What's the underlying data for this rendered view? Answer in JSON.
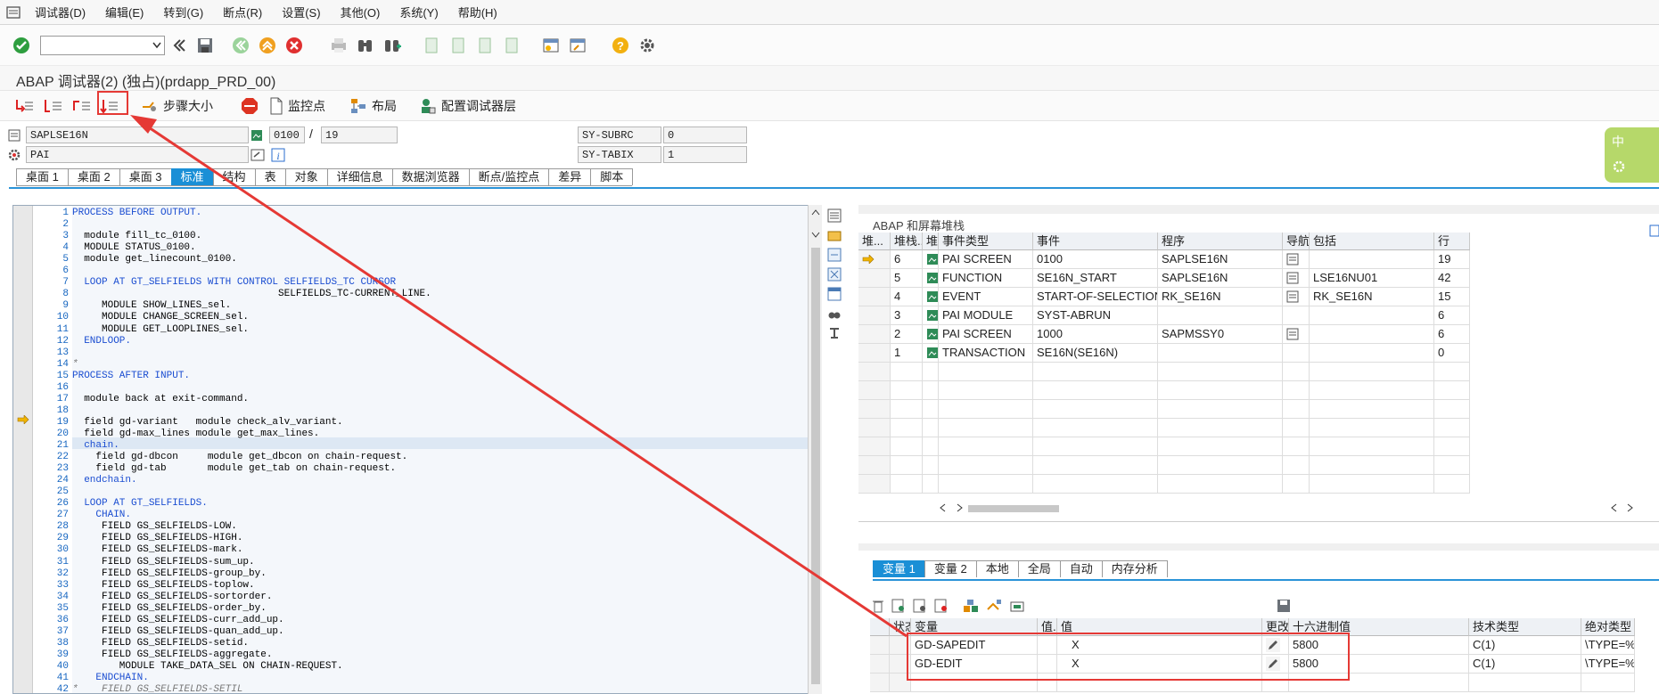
{
  "menu": [
    "调试器(D)",
    "编辑(E)",
    "转到(G)",
    "断点(R)",
    "设置(S)",
    "其他(O)",
    "系统(Y)",
    "帮助(H)"
  ],
  "title": "ABAP 调试器(2)   (独占)(prdapp_PRD_00)",
  "app_toolbar": {
    "step_size": "步骤大小",
    "watchpoint": "监控点",
    "layout": "布局",
    "config_layer": "配置调试器层"
  },
  "fields": {
    "program": "SAPLSE16N",
    "screen": "0100",
    "slash": "/",
    "line": "19",
    "event": "PAI",
    "sy_subrc_label": "SY-SUBRC",
    "sy_subrc_value": "0",
    "sy_tabix_label": "SY-TABIX",
    "sy_tabix_value": "1"
  },
  "ime_label": "中",
  "main_tabs": [
    "桌面 1",
    "桌面 2",
    "桌面 3",
    "标准",
    "结构",
    "表",
    "对象",
    "详细信息",
    "数据浏览器",
    "断点/监控点",
    "差异",
    "脚本"
  ],
  "active_main_tab": 3,
  "code_lines": [
    {
      "n": "1",
      "t": "PROCESS BEFORE OUTPUT."
    },
    {
      "n": "2",
      "t": ""
    },
    {
      "n": "3",
      "t": "  module fill_tc_0100."
    },
    {
      "n": "4",
      "t": "  MODULE STATUS_0100."
    },
    {
      "n": "5",
      "t": "  module get_linecount_0100."
    },
    {
      "n": "6",
      "t": ""
    },
    {
      "n": "7",
      "t": "  LOOP AT GT_SELFIELDS WITH CONTROL SELFIELDS_TC CURSOR"
    },
    {
      "n": "8",
      "t": "                                   SELFIELDS_TC-CURRENT_LINE."
    },
    {
      "n": "9",
      "t": "     MODULE SHOW_LINES_sel."
    },
    {
      "n": "10",
      "t": "     MODULE CHANGE_SCREEN_sel."
    },
    {
      "n": "11",
      "t": "     MODULE GET_LOOPLINES_sel."
    },
    {
      "n": "12",
      "t": "  ENDLOOP."
    },
    {
      "n": "13",
      "t": ""
    },
    {
      "n": "14",
      "t": "*"
    },
    {
      "n": "15",
      "t": "PROCESS AFTER INPUT."
    },
    {
      "n": "16",
      "t": ""
    },
    {
      "n": "17",
      "t": "  module back at exit-command."
    },
    {
      "n": "18",
      "t": ""
    },
    {
      "n": "19",
      "t": "  field gd-variant   module check_alv_variant."
    },
    {
      "n": "20",
      "t": "  field gd-max_lines module get_max_lines."
    },
    {
      "n": "21",
      "t": "  chain."
    },
    {
      "n": "22",
      "t": "    field gd-dbcon     module get_dbcon on chain-request."
    },
    {
      "n": "23",
      "t": "    field gd-tab       module get_tab on chain-request."
    },
    {
      "n": "24",
      "t": "  endchain."
    },
    {
      "n": "25",
      "t": ""
    },
    {
      "n": "26",
      "t": "  LOOP AT GT_SELFIELDS."
    },
    {
      "n": "27",
      "t": "    CHAIN."
    },
    {
      "n": "28",
      "t": "     FIELD GS_SELFIELDS-LOW."
    },
    {
      "n": "29",
      "t": "     FIELD GS_SELFIELDS-HIGH."
    },
    {
      "n": "30",
      "t": "     FIELD GS_SELFIELDS-mark."
    },
    {
      "n": "31",
      "t": "     FIELD GS_SELFIELDS-sum_up."
    },
    {
      "n": "32",
      "t": "     FIELD GS_SELFIELDS-group_by."
    },
    {
      "n": "33",
      "t": "     FIELD GS_SELFIELDS-toplow."
    },
    {
      "n": "34",
      "t": "     FIELD GS_SELFIELDS-sortorder."
    },
    {
      "n": "35",
      "t": "     FIELD GS_SELFIELDS-order_by."
    },
    {
      "n": "36",
      "t": "     FIELD GS_SELFIELDS-curr_add_up."
    },
    {
      "n": "37",
      "t": "     FIELD GS_SELFIELDS-quan_add_up."
    },
    {
      "n": "38",
      "t": "     FIELD GS_SELFIELDS-setid."
    },
    {
      "n": "39",
      "t": "     FIELD GS_SELFIELDS-aggregate."
    },
    {
      "n": "40",
      "t": "        MODULE TAKE_DATA_SEL ON CHAIN-REQUEST."
    },
    {
      "n": "41",
      "t": "    ENDCHAIN."
    },
    {
      "n": "42",
      "t": "*    FIELD GS_SELFIELDS-SETIL"
    }
  ],
  "stack_panel": {
    "title": "ABAP 和屏幕堆栈",
    "headers": [
      "堆...",
      "堆栈...",
      "堆.",
      "事件类型",
      "事件",
      "程序",
      "导航",
      "包括",
      "行"
    ],
    "rows": [
      {
        "depth": "6",
        "type": "PAI SCREEN",
        "event": "0100",
        "program": "SAPLSE16N",
        "include": "",
        "line": "19",
        "nav": true,
        "current": true
      },
      {
        "depth": "5",
        "type": "FUNCTION",
        "event": "SE16N_START",
        "program": "SAPLSE16N",
        "include": "LSE16NU01",
        "line": "42",
        "nav": true,
        "current": false
      },
      {
        "depth": "4",
        "type": "EVENT",
        "event": "START-OF-SELECTION",
        "program": "RK_SE16N",
        "include": "RK_SE16N",
        "line": "15",
        "nav": true,
        "current": false
      },
      {
        "depth": "3",
        "type": "PAI MODULE",
        "event": "SYST-ABRUN",
        "program": "",
        "include": "",
        "line": "6",
        "nav": false,
        "current": false
      },
      {
        "depth": "2",
        "type": "PAI SCREEN",
        "event": "1000",
        "program": "SAPMSSY0",
        "include": "",
        "line": "6",
        "nav": true,
        "current": false
      },
      {
        "depth": "1",
        "type": "TRANSACTION",
        "event": "SE16N(SE16N)",
        "program": "",
        "include": "",
        "line": "0",
        "nav": false,
        "current": false
      }
    ]
  },
  "var_tabs": [
    "变量 1",
    "变量 2",
    "本地",
    "全局",
    "自动",
    "内存分析"
  ],
  "var_headers": [
    "状态",
    "变量",
    "值...",
    "值",
    "更改",
    "十六进制值",
    "技术类型",
    "绝对类型"
  ],
  "var_rows": [
    {
      "name": "GD-SAPEDIT",
      "value": "X",
      "hex": "5800",
      "type": "C(1)",
      "abs": "\\TYPE=%_"
    },
    {
      "name": "GD-EDIT",
      "value": "X",
      "hex": "5800",
      "type": "C(1)",
      "abs": "\\TYPE=%_"
    }
  ],
  "colors": {
    "annotation": "#e53935",
    "accent": "#1a8fd6"
  }
}
